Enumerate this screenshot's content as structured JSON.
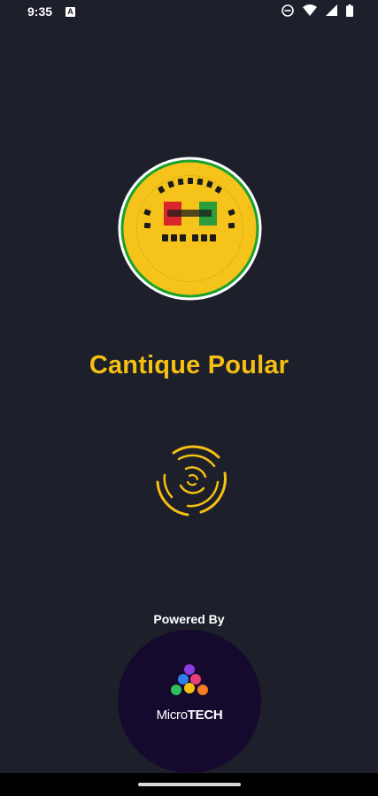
{
  "status_bar": {
    "time": "9:35",
    "notification_icon": "A",
    "icons": [
      "do-not-disturb-icon",
      "wifi-icon",
      "cellular-signal-icon",
      "battery-icon"
    ]
  },
  "splash": {
    "logo_icon": "cantique-poular-emblem",
    "app_title": "Cantique Poular",
    "loader_icon": "spinner-icon",
    "accent_color": "#f5c012",
    "background_color": "#1d1f2b"
  },
  "footer": {
    "powered_by": "Powered By",
    "brand_logo_icon": "microtech-logo",
    "brand_name_part1": "Micro",
    "brand_name_part2": "TECH"
  }
}
